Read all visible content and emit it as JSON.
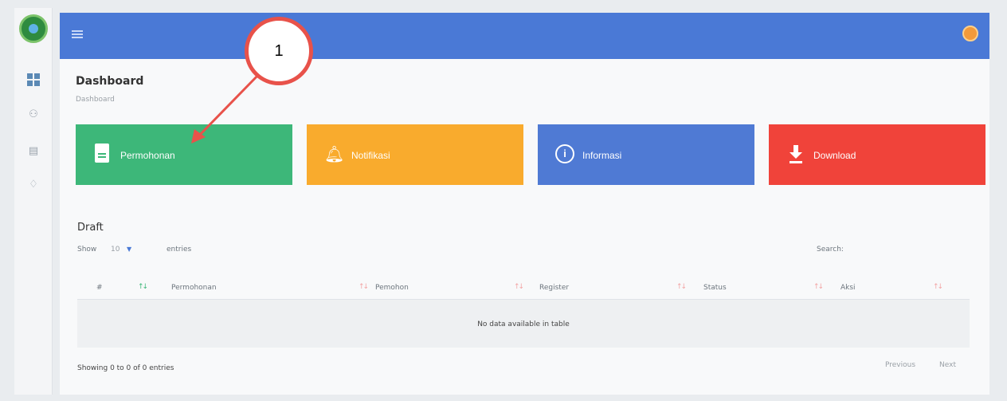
{
  "header": {
    "menu_icon": "hamburger-icon",
    "avatar_color": "#f39a3a",
    "bar_color": "#4a79d6"
  },
  "sidebar": {
    "items": [
      {
        "icon": "dashboard-grid-icon"
      },
      {
        "icon": "users-icon"
      },
      {
        "icon": "document-icon"
      },
      {
        "icon": "bell-icon"
      }
    ]
  },
  "page": {
    "title": "Dashboard",
    "breadcrumb": "Dashboard"
  },
  "cards": [
    {
      "label": "Permohonan",
      "icon": "document-icon",
      "color": "#3db779"
    },
    {
      "label": "Notifikasi",
      "icon": "bell-icon",
      "color": "#f9ab2d"
    },
    {
      "label": "Informasi",
      "icon": "info-icon",
      "color": "#4f7ad4"
    },
    {
      "label": "Download",
      "icon": "download-icon",
      "color": "#f0433a"
    }
  ],
  "draft": {
    "title": "Draft",
    "show_label": "Show",
    "entries_value": "10",
    "entries_label": "entries",
    "search_label": "Search:",
    "columns": [
      "#",
      "Permohonan",
      "Pemohon",
      "Register",
      "Status",
      "Aksi"
    ],
    "empty_message": "No data available in table",
    "showing_text": "Showing 0 to 0 of 0 entries",
    "prev_label": "Previous",
    "next_label": "Next"
  },
  "annotation": {
    "number": "1",
    "color": "#e8524a"
  }
}
